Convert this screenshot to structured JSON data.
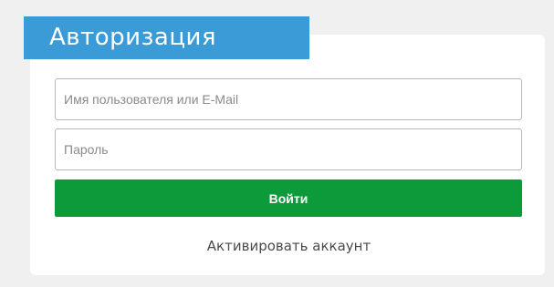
{
  "auth": {
    "title": "Авторизация",
    "username_placeholder": "Имя пользователя или E-Mail",
    "username_value": "",
    "password_placeholder": "Пароль",
    "password_value": "",
    "login_label": "Войти",
    "activate_label": "Активировать аккаунт"
  },
  "colors": {
    "header": "#3a9bd6",
    "button": "#0c9a3b",
    "background": "#f0f0f0"
  }
}
